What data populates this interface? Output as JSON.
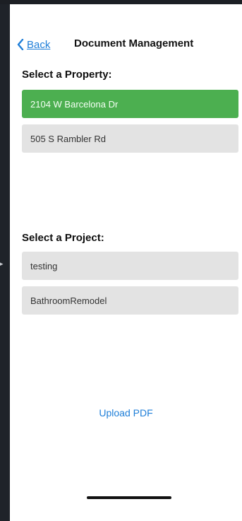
{
  "nav": {
    "back_label": "Back",
    "title": "Document Management"
  },
  "properties": {
    "heading": "Select a Property:",
    "items": [
      {
        "label": "2104 W Barcelona Dr",
        "selected": true
      },
      {
        "label": "505 S Rambler Rd",
        "selected": false
      }
    ]
  },
  "projects": {
    "heading": "Select a Project:",
    "items": [
      {
        "label": "testing",
        "selected": false
      },
      {
        "label": "BathroomRemodel",
        "selected": false
      }
    ]
  },
  "actions": {
    "upload_label": "Upload PDF"
  },
  "colors": {
    "accent": "#1e7ed8",
    "selected": "#4caf50",
    "item_bg": "#e3e3e3"
  },
  "icons": {
    "back": "chevron-left-icon",
    "side": "arrow-right-icon"
  }
}
